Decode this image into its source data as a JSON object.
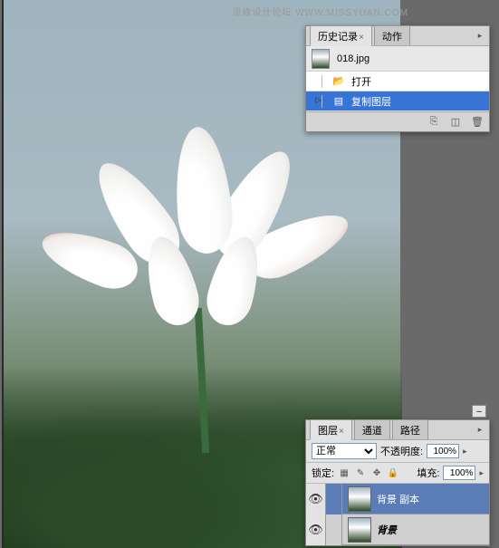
{
  "watermark": "思缘设计论坛   WWW.MISSYUAN.COM",
  "history_panel": {
    "tabs": [
      {
        "label": "历史记录",
        "active": true
      },
      {
        "label": "动作",
        "active": false
      }
    ],
    "document": "018.jpg",
    "items": [
      {
        "icon": "folder-open-icon",
        "label": "打开",
        "selected": false
      },
      {
        "icon": "layers-icon",
        "label": "复制图层",
        "selected": true
      }
    ]
  },
  "layers_panel": {
    "tabs": [
      {
        "label": "图层",
        "active": true
      },
      {
        "label": "通道",
        "active": false
      },
      {
        "label": "路径",
        "active": false
      }
    ],
    "blend_mode": "正常",
    "opacity_label": "不透明度:",
    "opacity_value": "100%",
    "lock_label": "锁定:",
    "fill_label": "填充:",
    "fill_value": "100%",
    "layers": [
      {
        "name": "背景 副本",
        "selected": true,
        "italic": false
      },
      {
        "name": "背景",
        "selected": false,
        "italic": true
      }
    ]
  }
}
